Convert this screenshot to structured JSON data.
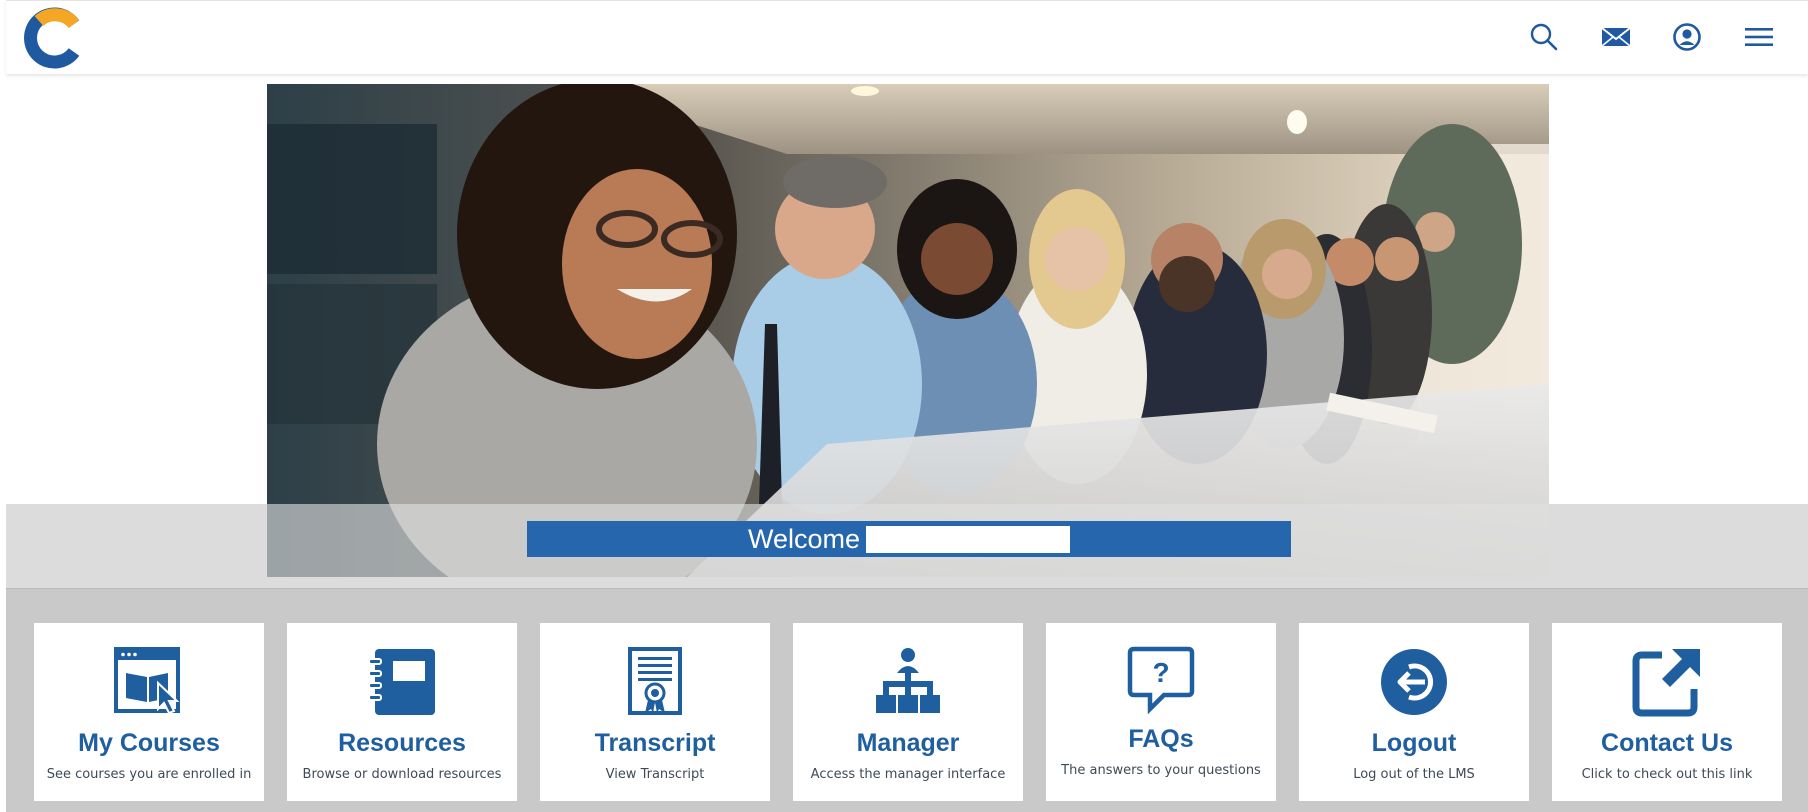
{
  "header": {
    "logo_name": "c-logo-icon",
    "actions": [
      {
        "name": "search-icon"
      },
      {
        "name": "mail-icon"
      },
      {
        "name": "profile-icon"
      },
      {
        "name": "menu-icon"
      }
    ]
  },
  "hero": {
    "image_subject": "group of smiling business professionals seated at a conference table",
    "welcome_label": "Welcome",
    "user_name": ""
  },
  "tiles": [
    {
      "title": "My Courses",
      "subtitle": "See courses you are enrolled in",
      "icon": "courses-icon"
    },
    {
      "title": "Resources",
      "subtitle": "Browse or download resources",
      "icon": "notebook-icon"
    },
    {
      "title": "Transcript",
      "subtitle": "View Transcript",
      "icon": "certificate-icon"
    },
    {
      "title": "Manager",
      "subtitle": "Access the manager interface",
      "icon": "org-chart-icon"
    },
    {
      "title": "FAQs",
      "subtitle": "The answers to your questions",
      "icon": "question-bubble-icon"
    },
    {
      "title": "Logout",
      "subtitle": "Log out of the LMS",
      "icon": "logout-icon"
    },
    {
      "title": "Contact Us",
      "subtitle": "Click to check out this link",
      "icon": "external-link-icon"
    }
  ],
  "colors": {
    "brand_blue": "#2566ad",
    "tile_title": "#1f5e9f",
    "logo_orange": "#f5a623",
    "logo_blue": "#1f5aa0",
    "tile_band": "#c9c9c9",
    "hero_band": "#dcdcdc"
  }
}
